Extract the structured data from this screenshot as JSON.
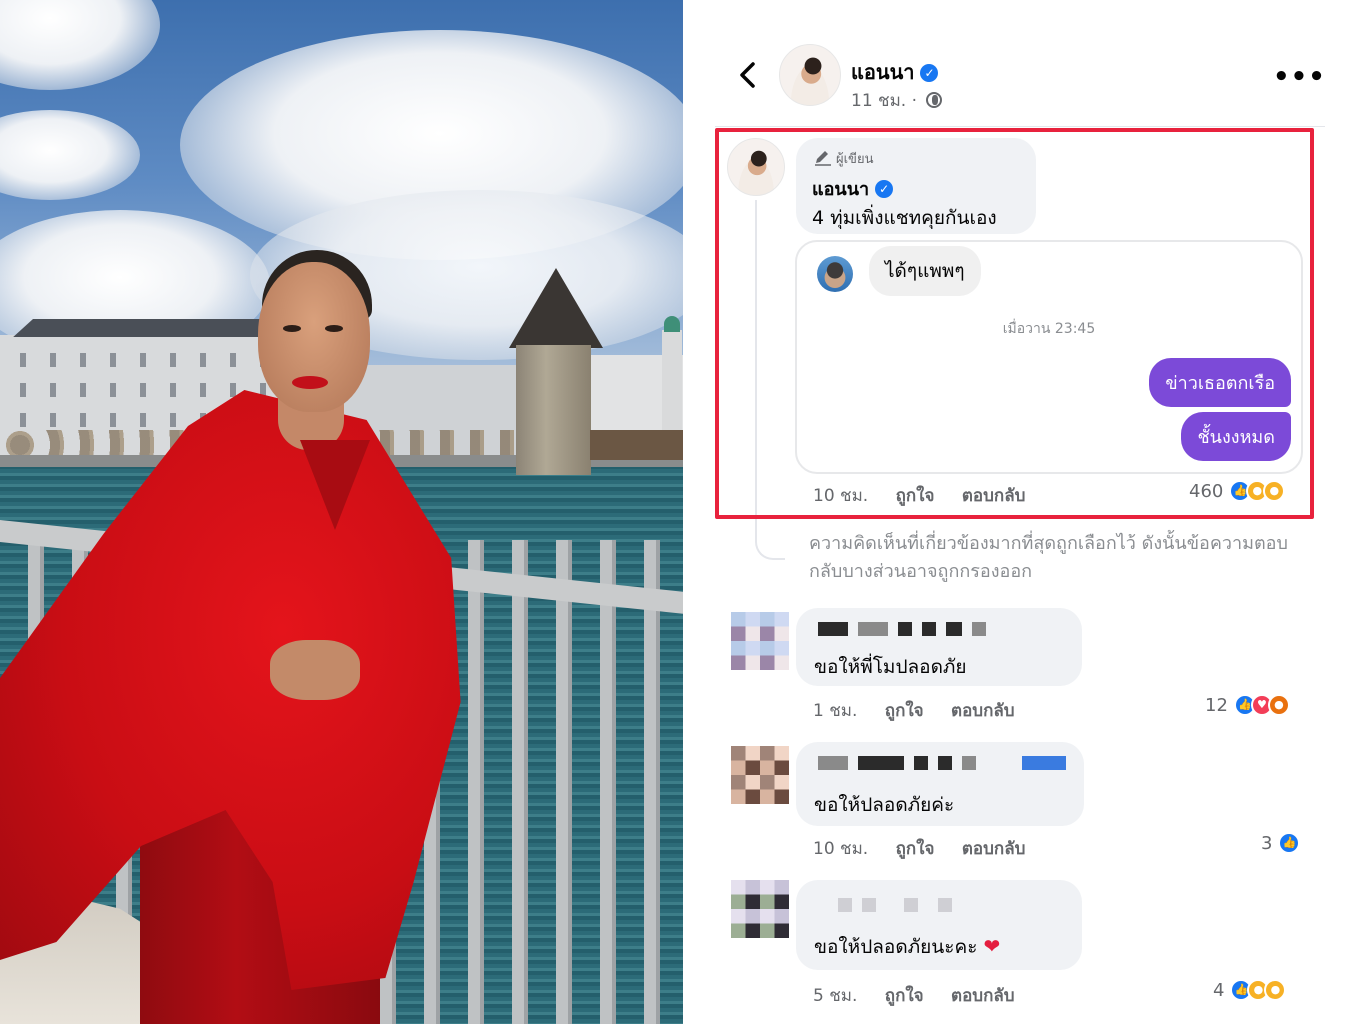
{
  "post": {
    "author": "แอนนา",
    "time": "11 ชม. ·",
    "more": "•••"
  },
  "highlighted_comment": {
    "tag": "ผู้เขียน",
    "name": "แอนนา",
    "text": "4 ทุ่มเพิ่งแชทคุยกันเอง",
    "chat": {
      "incoming": "ได้ๆแพพๆ",
      "timestamp": "เมื่อวาน 23:45",
      "outgoing_1": "ข่าวเธอตกเรือ",
      "outgoing_2": "ชั้นงงหมด"
    },
    "time": "10 ชม.",
    "like": "ถูกใจ",
    "reply": "ตอบกลับ",
    "reaction_count": "460",
    "reactions": [
      "like",
      "care",
      "sad"
    ]
  },
  "filter_note": "ความคิดเห็นที่เกี่ยวข้องมากที่สุดถูกเลือกไว้ ดังนั้นข้อความตอบกลับบางส่วนอาจถูกกรองออก",
  "comments": [
    {
      "text": "ขอให้พี่โมปลอดภัย",
      "time": "1 ชม.",
      "like": "ถูกใจ",
      "reply": "ตอบกลับ",
      "reaction_count": "12",
      "reactions": [
        "like",
        "love",
        "angry"
      ]
    },
    {
      "text": "ขอให้ปลอดภัยค่ะ",
      "time": "10 ชม.",
      "like": "ถูกใจ",
      "reply": "ตอบกลับ",
      "reaction_count": "3",
      "reactions": [
        "like"
      ]
    },
    {
      "text": "ขอให้ปลอดภัยนะคะ",
      "emoji": "❤",
      "time": "5 ชม.",
      "like": "ถูกใจ",
      "reply": "ตอบกลับ",
      "reaction_count": "4",
      "reactions": [
        "like",
        "wow",
        "sad"
      ]
    }
  ],
  "colors": {
    "highlight_border": "#e8223d",
    "chat_bubble": "#7c4ad8",
    "verified": "#1877f2"
  }
}
